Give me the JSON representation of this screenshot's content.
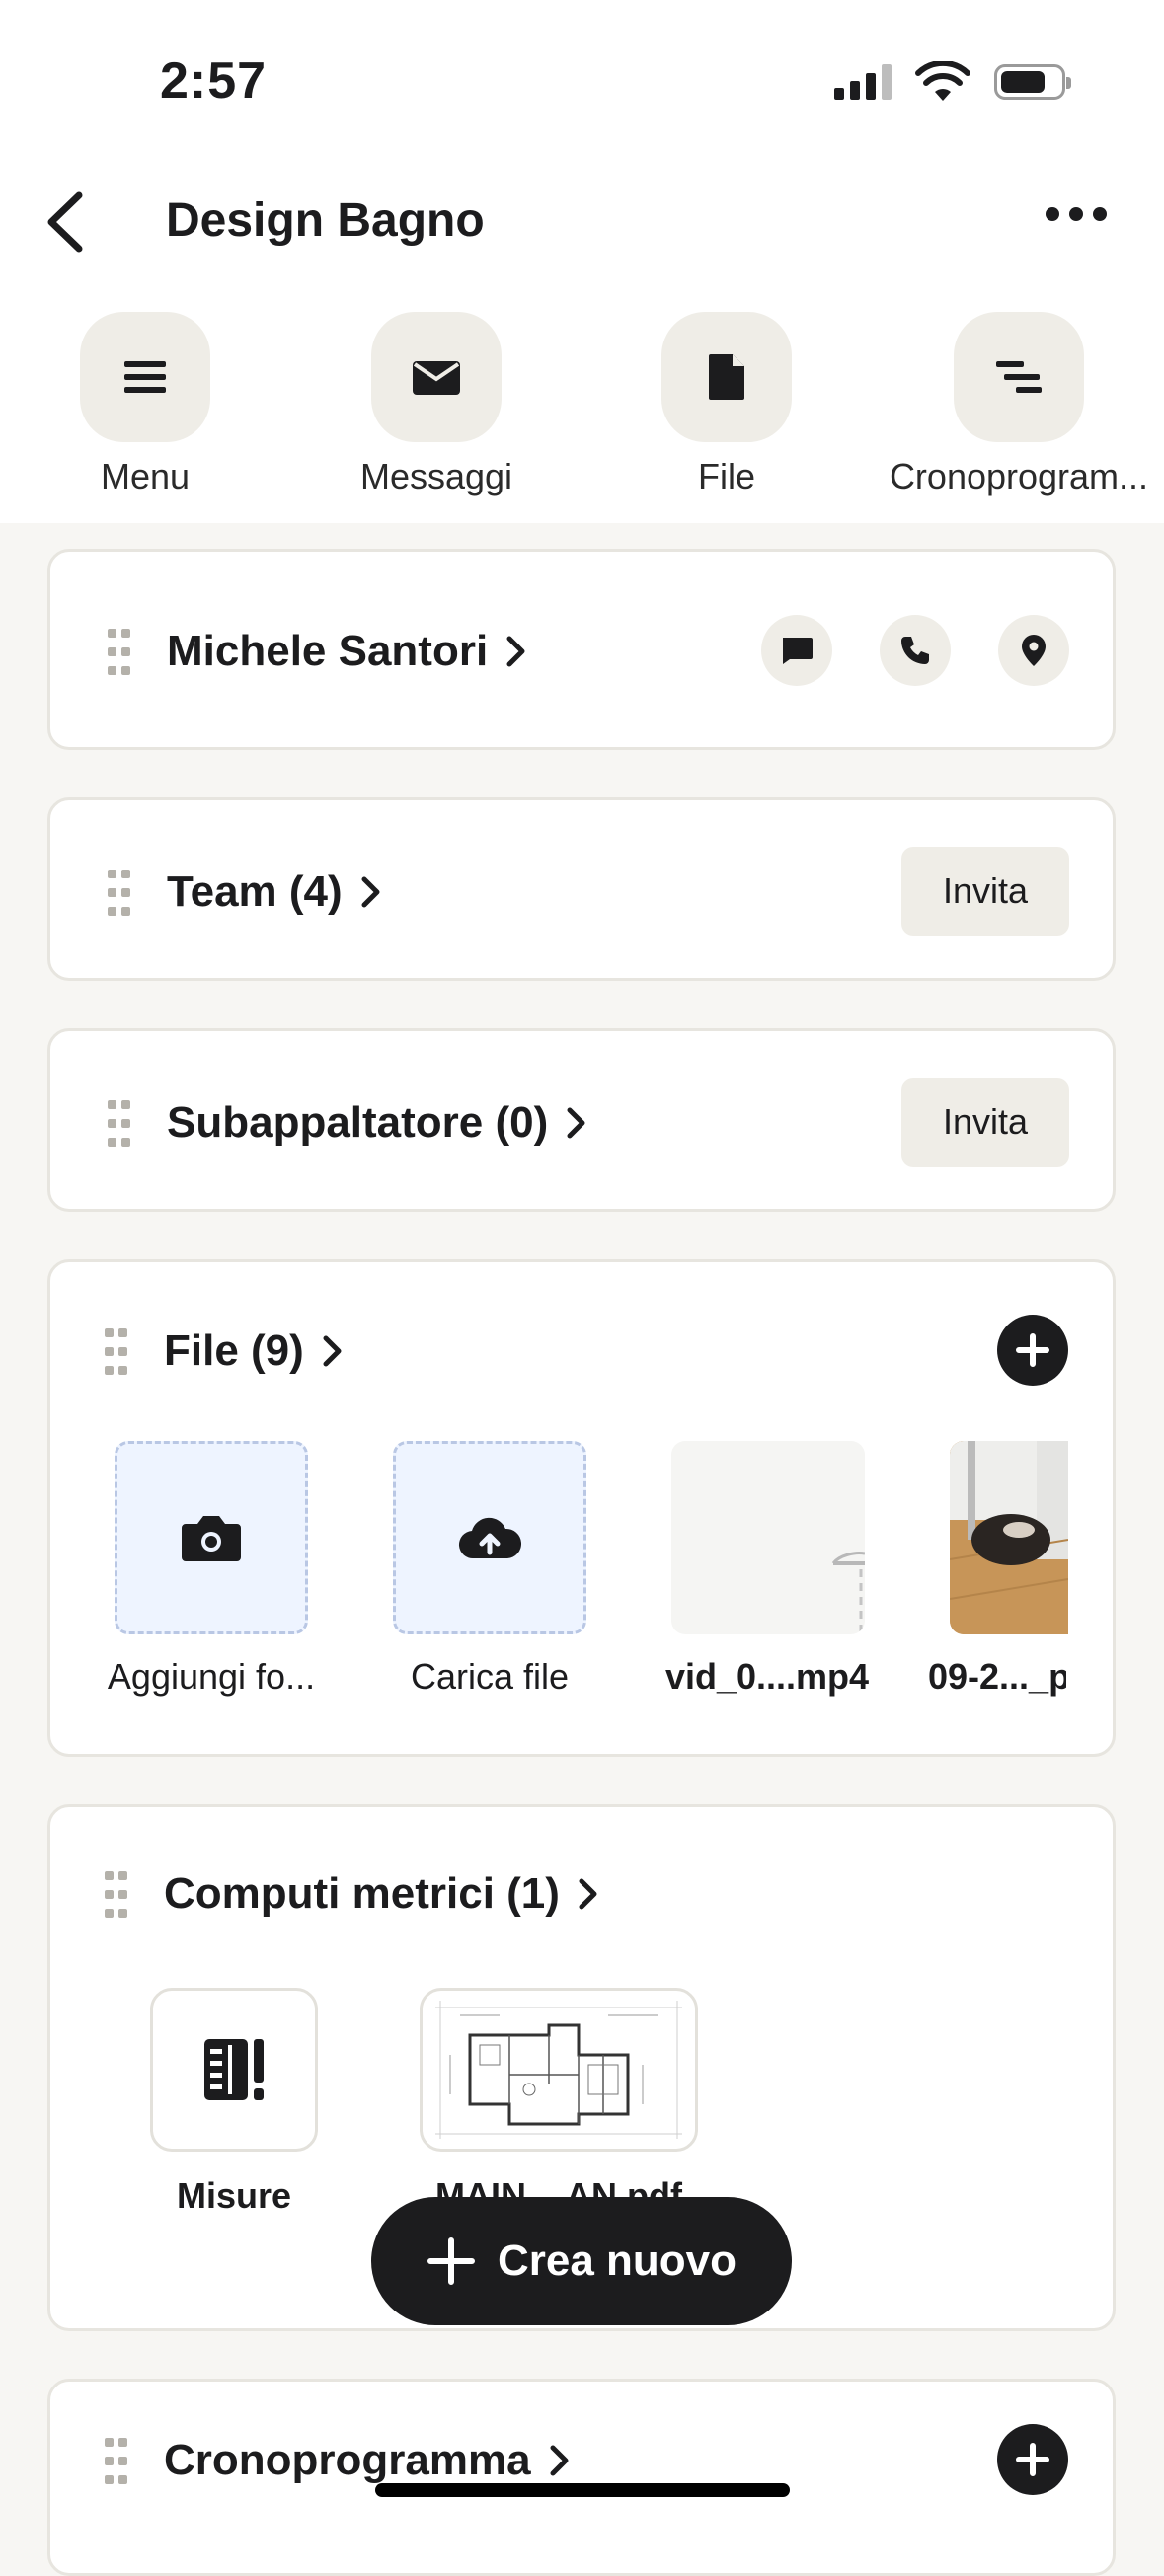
{
  "status": {
    "time": "2:57"
  },
  "header": {
    "title": "Design Bagno"
  },
  "quick_actions": [
    {
      "label": "Menu",
      "icon": "menu-icon"
    },
    {
      "label": "Messaggi",
      "icon": "envelope-icon"
    },
    {
      "label": "File",
      "icon": "document-icon"
    },
    {
      "label": "Cronoprogram...",
      "icon": "timeline-icon"
    }
  ],
  "client": {
    "name": "Michele Santori"
  },
  "team": {
    "title": "Team (4)",
    "invite_label": "Invita"
  },
  "subcontractor": {
    "title": "Subappaltatore (0)",
    "invite_label": "Invita"
  },
  "files": {
    "title": "File (9)",
    "items": [
      {
        "label": "Aggiungi fo...",
        "icon": "camera-icon"
      },
      {
        "label": "Carica file",
        "icon": "cloud-upload-icon"
      },
      {
        "label": "vid_0....mp4",
        "icon": "video-thumbnail"
      },
      {
        "label": "09-2..._p",
        "icon": "photo-thumbnail"
      }
    ]
  },
  "computi": {
    "title": "Computi metrici (1)",
    "items": [
      {
        "label": "Misure",
        "icon": "measure-icon"
      },
      {
        "label": "MAIN....AN.pdf",
        "icon": "floorplan-thumbnail"
      }
    ]
  },
  "schedule": {
    "title": "Cronoprogramma"
  },
  "fab": {
    "label": "Crea nuovo"
  }
}
